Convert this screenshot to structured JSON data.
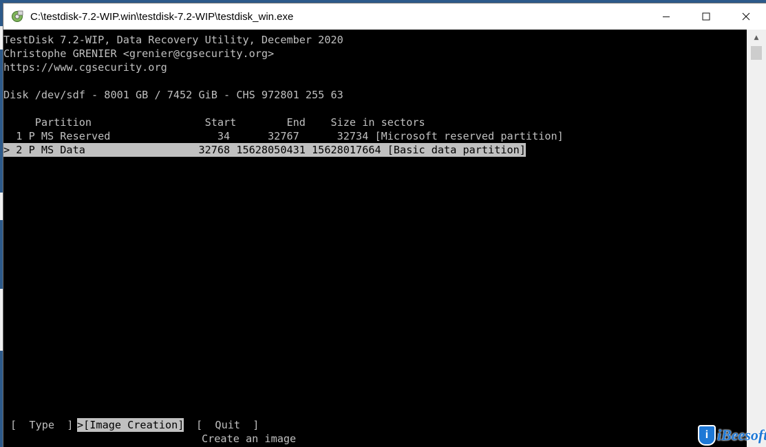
{
  "window": {
    "title": "C:\\testdisk-7.2-WIP.win\\testdisk-7.2-WIP\\testdisk_win.exe"
  },
  "console": {
    "header": [
      "TestDisk 7.2-WIP, Data Recovery Utility, December 2020",
      "Christophe GRENIER <grenier@cgsecurity.org>",
      "https://www.cgsecurity.org"
    ],
    "disk_info": "Disk /dev/sdf - 8001 GB / 7452 GiB - CHS 972801 255 63",
    "table_header": "     Partition                  Start        End    Size in sectors",
    "partitions": [
      {
        "text": "  1 P MS Reserved                 34      32767      32734 [Microsoft reserved partition]",
        "selected": false
      },
      {
        "text": "> 2 P MS Data                  32768 15628050431 15628017664 [Basic data partition]",
        "selected": true
      }
    ],
    "menu": {
      "type": "[  Type  ]",
      "image_creation": ">[Image Creation]",
      "quit": "[  Quit  ]"
    },
    "hint": "Create an image"
  },
  "watermark": {
    "text": "iBeesoft",
    "badge": "i"
  },
  "colors": {
    "console_bg": "#000000",
    "console_fg": "#c0c0c0",
    "highlight_bg": "#c0c0c0",
    "highlight_fg": "#000000",
    "watermark": "#1e78d6"
  }
}
